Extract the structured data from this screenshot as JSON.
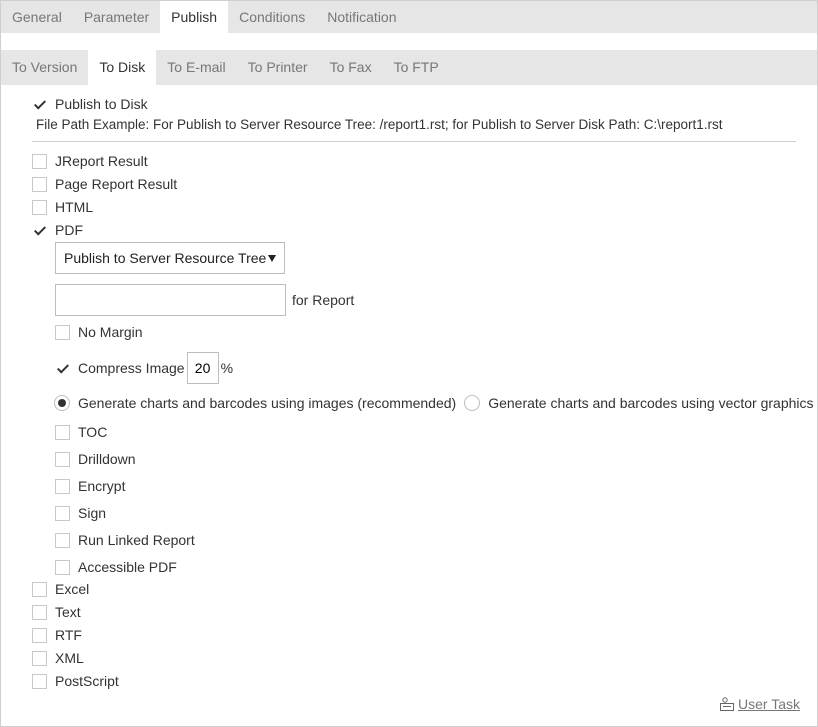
{
  "top_tabs": [
    "General",
    "Parameter",
    "Publish",
    "Conditions",
    "Notification"
  ],
  "top_tab_active": "Publish",
  "sub_tabs": [
    "To Version",
    "To Disk",
    "To E-mail",
    "To Printer",
    "To Fax",
    "To FTP"
  ],
  "sub_tab_active": "To Disk",
  "publish_to_disk": {
    "label": "Publish to Disk",
    "checked": true
  },
  "hint": "File Path Example: For Publish to Server Resource Tree: /report1.rst; for Publish to Server Disk Path: C:\\report1.rst",
  "formats_top": [
    {
      "label": "JReport Result",
      "checked": false
    },
    {
      "label": "Page Report Result",
      "checked": false
    },
    {
      "label": "HTML",
      "checked": false
    },
    {
      "label": "PDF",
      "checked": true
    }
  ],
  "pdf": {
    "destination": "Publish to Server Resource Tree",
    "path_value": "",
    "for_report": "for Report",
    "no_margin": {
      "label": "No Margin",
      "checked": false
    },
    "compress_image": {
      "label": "Compress Image",
      "checked": true,
      "value": "20",
      "unit": "%"
    },
    "radio_images": {
      "label": "Generate charts and barcodes using images (recommended)",
      "selected": true
    },
    "radio_vector": {
      "label": "Generate charts and barcodes using vector graphics",
      "selected": false
    },
    "options": [
      {
        "label": "TOC",
        "checked": false
      },
      {
        "label": "Drilldown",
        "checked": false
      },
      {
        "label": "Encrypt",
        "checked": false
      },
      {
        "label": "Sign",
        "checked": false
      },
      {
        "label": "Run Linked Report",
        "checked": false
      },
      {
        "label": "Accessible PDF",
        "checked": false
      }
    ]
  },
  "formats_bottom": [
    {
      "label": "Excel",
      "checked": false
    },
    {
      "label": "Text",
      "checked": false
    },
    {
      "label": "RTF",
      "checked": false
    },
    {
      "label": "XML",
      "checked": false
    },
    {
      "label": "PostScript",
      "checked": false
    }
  ],
  "user_task": "User Task",
  "icons": {
    "checkbox_check": "check-icon",
    "dropdown": "triangle-down-icon",
    "user_task": "user-task-icon"
  }
}
